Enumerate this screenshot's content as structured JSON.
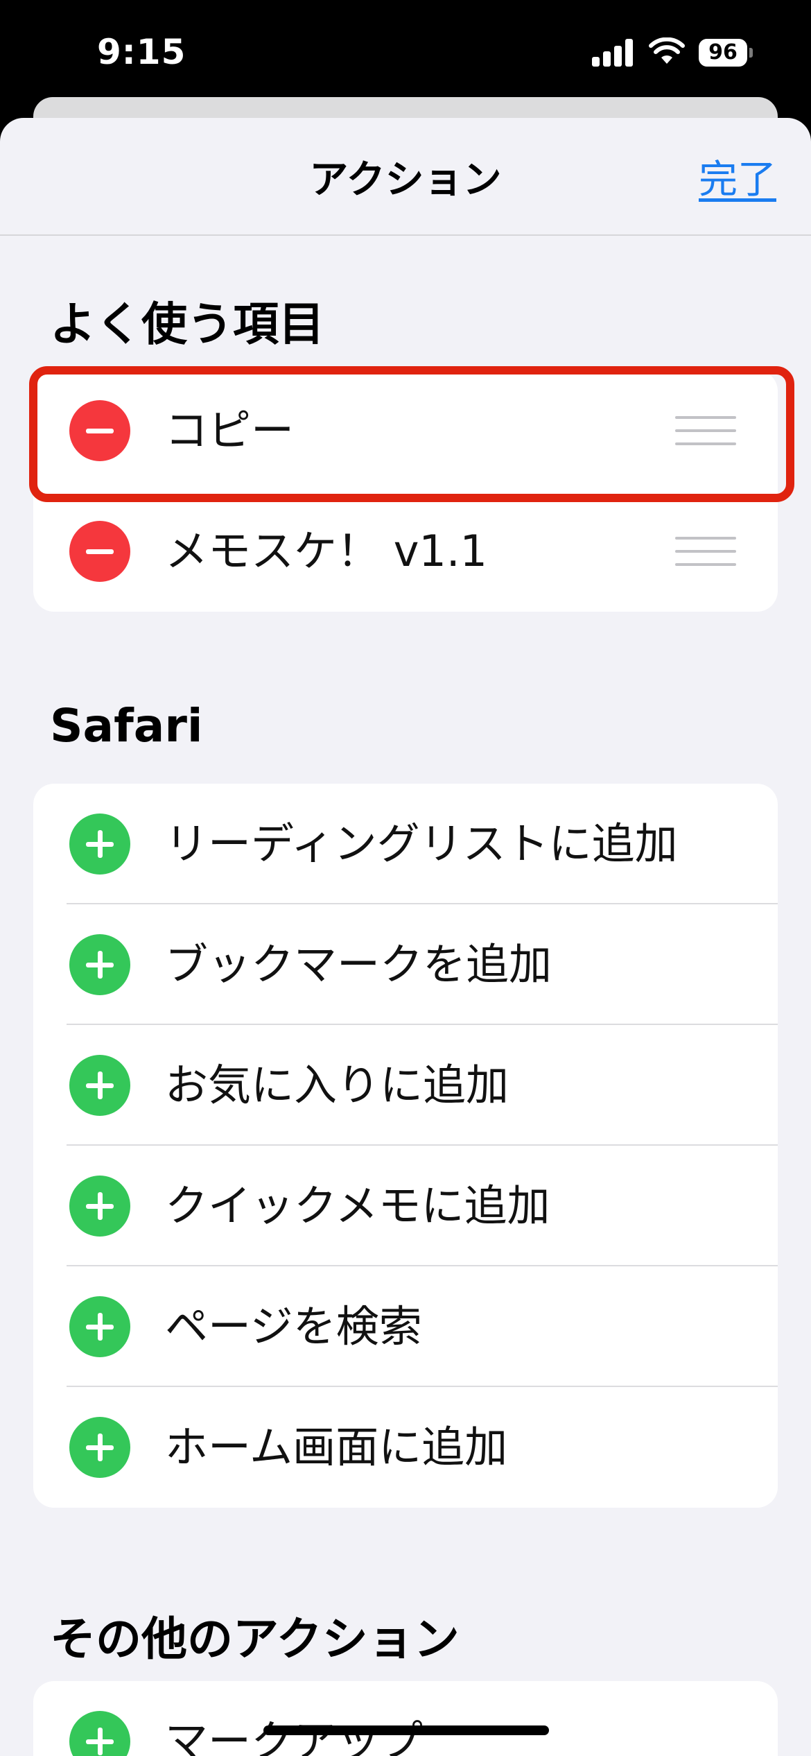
{
  "status_bar": {
    "time": "9:15",
    "battery": "96"
  },
  "nav": {
    "title": "アクション",
    "done_label": "完了"
  },
  "favorites": {
    "header": "よく使う項目",
    "items": [
      {
        "label": "コピー"
      },
      {
        "label": "メモスケ！ v1.1"
      }
    ]
  },
  "safari": {
    "header": "Safari",
    "items": [
      {
        "label": "リーディングリストに追加"
      },
      {
        "label": "ブックマークを追加"
      },
      {
        "label": "お気に入りに追加"
      },
      {
        "label": "クイックメモに追加"
      },
      {
        "label": "ページを検索"
      },
      {
        "label": "ホーム画面に追加"
      }
    ]
  },
  "other": {
    "header": "その他のアクション",
    "items": [
      {
        "label": "マークアップ"
      }
    ]
  },
  "colors": {
    "accent": "#1a7cf0",
    "remove": "#f5373d",
    "add": "#34c759",
    "highlight": "#e0230f"
  }
}
